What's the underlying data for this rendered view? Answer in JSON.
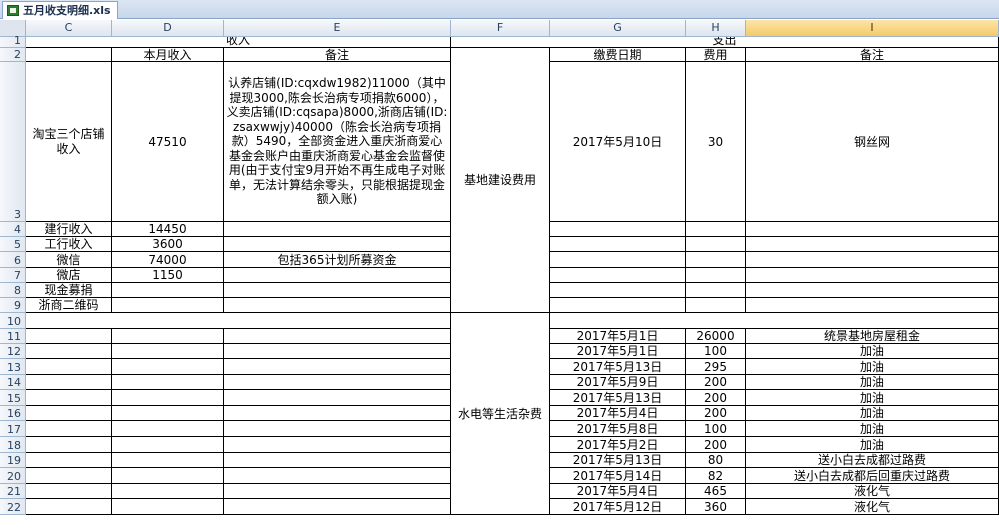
{
  "tab": {
    "filename": "五月收支明细.xls"
  },
  "columns": [
    "C",
    "D",
    "E",
    "F",
    "G",
    "H",
    "I"
  ],
  "selected_column": "I",
  "rows": [
    "1",
    "2",
    "3",
    "4",
    "5",
    "6",
    "7",
    "8",
    "9",
    "10",
    "11",
    "12",
    "13",
    "14",
    "15",
    "16",
    "17",
    "18",
    "19",
    "20",
    "21",
    "22"
  ],
  "income": {
    "title": "收入",
    "header_amount": "本月收入",
    "header_note": "备注",
    "items": [
      {
        "label": "淘宝三个店铺收入",
        "amount": "47510",
        "note": "认养店铺(ID:cqxdw1982)11000（其中提现3000,陈会长治病专项捐款6000），义卖店铺(ID:cqsapa)8000,浙商店铺(ID:zsaxwwjy)40000（陈会长治病专项捐款）5490，全部资金进入重庆浙商爱心基金会账户由重庆浙商爱心基金会监督使用(由于支付宝9月开始不再生成电子对账单，无法计算结余零头，只能根据提现金额入账)"
      },
      {
        "label": "建行收入",
        "amount": "14450",
        "note": ""
      },
      {
        "label": "工行收入",
        "amount": "3600",
        "note": ""
      },
      {
        "label": "微信",
        "amount": "74000",
        "note": "包括365计划所募资金"
      },
      {
        "label": "微店",
        "amount": "1150",
        "note": ""
      },
      {
        "label": "现金募捐",
        "amount": "",
        "note": ""
      },
      {
        "label": "浙商二维码",
        "amount": "",
        "note": ""
      }
    ]
  },
  "expense": {
    "title": "支出",
    "header_date": "缴费日期",
    "header_cost": "费用",
    "header_note": "备注",
    "category_construction": "基地建设费用",
    "category_utilities": "水电等生活杂费",
    "construction": {
      "date": "2017年5月10日",
      "cost": "30",
      "note": "钢丝网"
    },
    "items": [
      {
        "date": "2017年5月1日",
        "cost": "26000",
        "note": "统景基地房屋租金"
      },
      {
        "date": "2017年5月1日",
        "cost": "100",
        "note": "加油"
      },
      {
        "date": "2017年5月13日",
        "cost": "295",
        "note": "加油"
      },
      {
        "date": "2017年5月9日",
        "cost": "200",
        "note": "加油"
      },
      {
        "date": "2017年5月13日",
        "cost": "200",
        "note": "加油"
      },
      {
        "date": "2017年5月4日",
        "cost": "200",
        "note": "加油"
      },
      {
        "date": "2017年5月8日",
        "cost": "100",
        "note": "加油"
      },
      {
        "date": "2017年5月2日",
        "cost": "200",
        "note": "加油"
      },
      {
        "date": "2017年5月13日",
        "cost": "80",
        "note": "送小白去成都过路费"
      },
      {
        "date": "2017年5月14日",
        "cost": "82",
        "note": "送小白去成都后回重庆过路费"
      },
      {
        "date": "2017年5月4日",
        "cost": "465",
        "note": "液化气"
      },
      {
        "date": "2017年5月12日",
        "cost": "360",
        "note": "液化气"
      }
    ]
  }
}
